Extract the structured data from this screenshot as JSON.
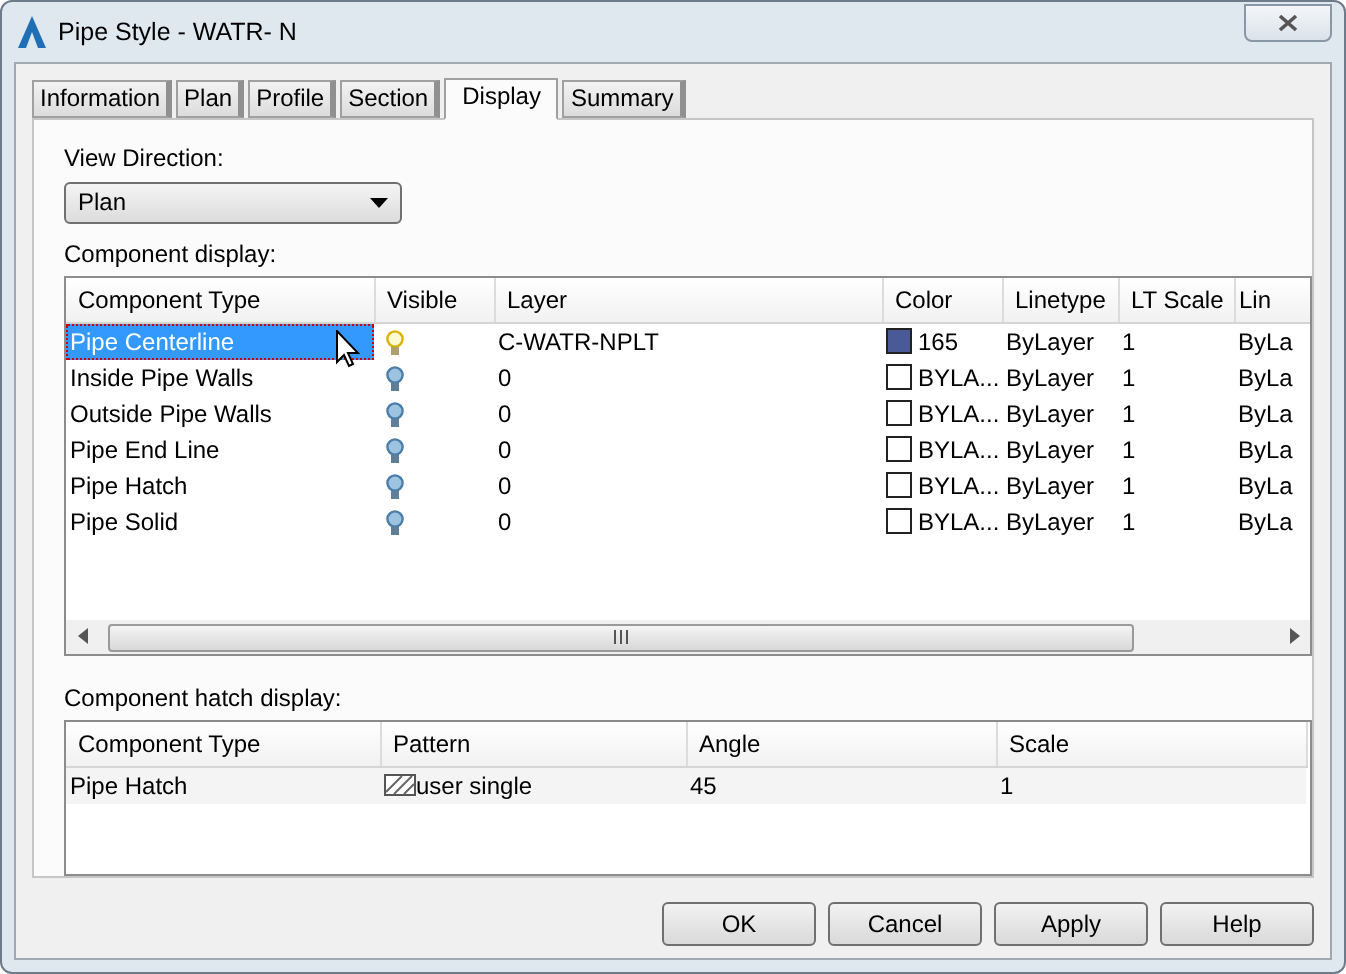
{
  "window": {
    "title": "Pipe Style - WATR- N"
  },
  "tabs": [
    {
      "label": "Information",
      "selected": false
    },
    {
      "label": "Plan",
      "selected": false
    },
    {
      "label": "Profile",
      "selected": false
    },
    {
      "label": "Section",
      "selected": false
    },
    {
      "label": "Display",
      "selected": true
    },
    {
      "label": "Summary",
      "selected": false
    }
  ],
  "view_direction": {
    "label": "View Direction:",
    "value": "Plan"
  },
  "component_display": {
    "label": "Component display:",
    "columns": [
      "Component Type",
      "Visible",
      "Layer",
      "Color",
      "Linetype",
      "LT Scale",
      "Lin"
    ],
    "rows": [
      {
        "component_type": "Pipe Centerline",
        "selected": true,
        "visible": true,
        "layer": "C-WATR-NPLT",
        "color": "#4a5a96",
        "color_label": "165",
        "linetype": "ByLayer",
        "lt_scale": "1",
        "column_7": "ByLa"
      },
      {
        "component_type": "Inside Pipe Walls",
        "selected": false,
        "visible": false,
        "layer": "0",
        "color": "#ffffff",
        "color_label": "BYLA...",
        "linetype": "ByLayer",
        "lt_scale": "1",
        "column_7": "ByLa"
      },
      {
        "component_type": "Outside Pipe Walls",
        "selected": false,
        "visible": false,
        "layer": "0",
        "color": "#ffffff",
        "color_label": "BYLA...",
        "linetype": "ByLayer",
        "lt_scale": "1",
        "column_7": "ByLa"
      },
      {
        "component_type": "Pipe End Line",
        "selected": false,
        "visible": false,
        "layer": "0",
        "color": "#ffffff",
        "color_label": "BYLA...",
        "linetype": "ByLayer",
        "lt_scale": "1",
        "column_7": "ByLa"
      },
      {
        "component_type": "Pipe Hatch",
        "selected": false,
        "visible": false,
        "layer": "0",
        "color": "#ffffff",
        "color_label": "BYLA...",
        "linetype": "ByLayer",
        "lt_scale": "1",
        "column_7": "ByLa"
      },
      {
        "component_type": "Pipe Solid",
        "selected": false,
        "visible": false,
        "layer": "0",
        "color": "#ffffff",
        "color_label": "BYLA...",
        "linetype": "ByLayer",
        "lt_scale": "1",
        "column_7": "ByLa"
      }
    ]
  },
  "hatch_display": {
    "label": "Component hatch display:",
    "columns": [
      "Component Type",
      "Pattern",
      "Angle",
      "Scale"
    ],
    "rows": [
      {
        "component_type": "Pipe Hatch",
        "pattern": "user single",
        "angle": "45",
        "scale": "1"
      }
    ]
  },
  "buttons": [
    {
      "label": "OK"
    },
    {
      "label": "Cancel"
    },
    {
      "label": "Apply"
    },
    {
      "label": "Help"
    }
  ]
}
